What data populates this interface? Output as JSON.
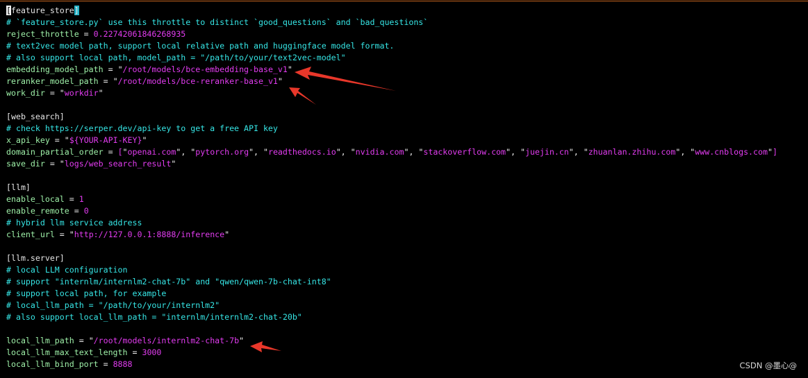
{
  "colors": {
    "comment": "#36e6e6",
    "key": "#9ef0a8",
    "string": "#e23cf0",
    "annotation_arrow": "#e8372a"
  },
  "cursor": {
    "line": 1,
    "column": 1
  },
  "lines": [
    [
      {
        "t": "[",
        "c": "cursor"
      },
      {
        "t": "feature_store",
        "c": "section"
      },
      {
        "t": "]",
        "c": "match"
      }
    ],
    [
      {
        "t": "# `feature_store.py` use this throttle to distinct `good_questions` and `bad_questions`",
        "c": "comment"
      }
    ],
    [
      {
        "t": "reject_throttle",
        "c": "key"
      },
      {
        "t": " = ",
        "c": "op"
      },
      {
        "t": "0.22742061846268935",
        "c": "num"
      }
    ],
    [
      {
        "t": "# text2vec model path, support local relative path and huggingface model format.",
        "c": "comment"
      }
    ],
    [
      {
        "t": "# also support local path, model_path = \"/path/to/your/text2vec-model\"",
        "c": "comment"
      }
    ],
    [
      {
        "t": "embedding_model_path",
        "c": "key"
      },
      {
        "t": " = ",
        "c": "op"
      },
      {
        "t": "\"",
        "c": "quote"
      },
      {
        "t": "/root/models/bce-embedding-base_v1",
        "c": "str"
      },
      {
        "t": "\"",
        "c": "quote"
      }
    ],
    [
      {
        "t": "reranker_model_path",
        "c": "key"
      },
      {
        "t": " = ",
        "c": "op"
      },
      {
        "t": "\"",
        "c": "quote"
      },
      {
        "t": "/root/models/bce-reranker-base_v1",
        "c": "str"
      },
      {
        "t": "\"",
        "c": "quote"
      }
    ],
    [
      {
        "t": "work_dir",
        "c": "key"
      },
      {
        "t": " = ",
        "c": "op"
      },
      {
        "t": "\"",
        "c": "quote"
      },
      {
        "t": "workdir",
        "c": "str"
      },
      {
        "t": "\"",
        "c": "quote"
      }
    ],
    [],
    [
      {
        "t": "[web_search]",
        "c": "section"
      }
    ],
    [
      {
        "t": "# check https://serper.dev/api-key to get a free API key",
        "c": "comment"
      }
    ],
    [
      {
        "t": "x_api_key",
        "c": "key"
      },
      {
        "t": " = ",
        "c": "op"
      },
      {
        "t": "\"",
        "c": "quote"
      },
      {
        "t": "${YOUR-API-KEY}",
        "c": "str"
      },
      {
        "t": "\"",
        "c": "quote"
      }
    ],
    [
      {
        "t": "domain_partial_order",
        "c": "key"
      },
      {
        "t": " = ",
        "c": "op"
      },
      {
        "t": "[",
        "c": "str"
      },
      {
        "t": "\"",
        "c": "quote"
      },
      {
        "t": "openai.com",
        "c": "str"
      },
      {
        "t": "\", \"",
        "c": "quote"
      },
      {
        "t": "pytorch.org",
        "c": "str"
      },
      {
        "t": "\", \"",
        "c": "quote"
      },
      {
        "t": "readthedocs.io",
        "c": "str"
      },
      {
        "t": "\", \"",
        "c": "quote"
      },
      {
        "t": "nvidia.com",
        "c": "str"
      },
      {
        "t": "\", \"",
        "c": "quote"
      },
      {
        "t": "stackoverflow.com",
        "c": "str"
      },
      {
        "t": "\", \"",
        "c": "quote"
      },
      {
        "t": "juejin.cn",
        "c": "str"
      },
      {
        "t": "\", \"",
        "c": "quote"
      },
      {
        "t": "zhuanlan.zhihu.com",
        "c": "str"
      },
      {
        "t": "\", \"",
        "c": "quote"
      },
      {
        "t": "www.cnblogs.com",
        "c": "str"
      },
      {
        "t": "\"",
        "c": "quote"
      },
      {
        "t": "]",
        "c": "str"
      }
    ],
    [
      {
        "t": "save_dir",
        "c": "key"
      },
      {
        "t": " = ",
        "c": "op"
      },
      {
        "t": "\"",
        "c": "quote"
      },
      {
        "t": "logs/web_search_result",
        "c": "str"
      },
      {
        "t": "\"",
        "c": "quote"
      }
    ],
    [],
    [
      {
        "t": "[llm]",
        "c": "section"
      }
    ],
    [
      {
        "t": "enable_local",
        "c": "key"
      },
      {
        "t": " = ",
        "c": "op"
      },
      {
        "t": "1",
        "c": "num"
      }
    ],
    [
      {
        "t": "enable_remote",
        "c": "key"
      },
      {
        "t": " = ",
        "c": "op"
      },
      {
        "t": "0",
        "c": "num"
      }
    ],
    [
      {
        "t": "# hybrid llm service address",
        "c": "comment"
      }
    ],
    [
      {
        "t": "client_url",
        "c": "key"
      },
      {
        "t": " = ",
        "c": "op"
      },
      {
        "t": "\"",
        "c": "quote"
      },
      {
        "t": "http://127.0.0.1:8888/inference",
        "c": "str"
      },
      {
        "t": "\"",
        "c": "quote"
      }
    ],
    [],
    [
      {
        "t": "[llm.server]",
        "c": "section"
      }
    ],
    [
      {
        "t": "# local LLM configuration",
        "c": "comment"
      }
    ],
    [
      {
        "t": "# support \"internlm/internlm2-chat-7b\" and \"qwen/qwen-7b-chat-int8\"",
        "c": "comment"
      }
    ],
    [
      {
        "t": "# support local path, for example",
        "c": "comment"
      }
    ],
    [
      {
        "t": "# local_llm_path = \"/path/to/your/internlm2\"",
        "c": "comment"
      }
    ],
    [
      {
        "t": "# also support local_llm_path = \"internlm/internlm2-chat-20b\"",
        "c": "comment"
      }
    ],
    [],
    [
      {
        "t": "local_llm_path",
        "c": "key"
      },
      {
        "t": " = ",
        "c": "op"
      },
      {
        "t": "\"",
        "c": "quote"
      },
      {
        "t": "/root/models/internlm2-chat-7b",
        "c": "str"
      },
      {
        "t": "\"",
        "c": "quote"
      }
    ],
    [
      {
        "t": "local_llm_max_text_length",
        "c": "key"
      },
      {
        "t": " = ",
        "c": "op"
      },
      {
        "t": "3000",
        "c": "num"
      }
    ],
    [
      {
        "t": "local_llm_bind_port",
        "c": "key"
      },
      {
        "t": " = ",
        "c": "op"
      },
      {
        "t": "8888",
        "c": "num"
      }
    ]
  ],
  "watermark": "CSDN @墨心@"
}
